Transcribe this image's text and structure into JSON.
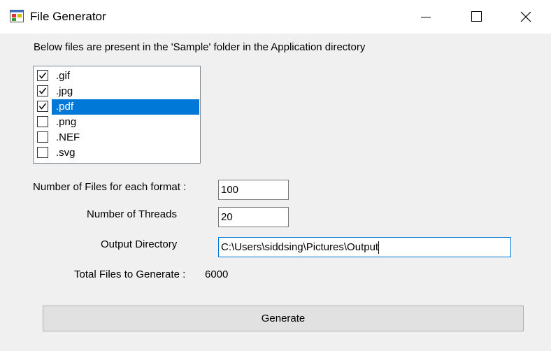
{
  "window": {
    "title": "File Generator",
    "icon": "app-form-icon"
  },
  "description": "Below files are present in the 'Sample'  folder in the Application directory",
  "formats": [
    {
      "label": ".gif",
      "checked": true,
      "selected": false
    },
    {
      "label": ".jpg",
      "checked": true,
      "selected": false
    },
    {
      "label": ".pdf",
      "checked": true,
      "selected": true
    },
    {
      "label": ".png",
      "checked": false,
      "selected": false
    },
    {
      "label": ".NEF",
      "checked": false,
      "selected": false
    },
    {
      "label": ".svg",
      "checked": false,
      "selected": false
    }
  ],
  "form": {
    "files_per_format_label": "Number of Files  for each format :",
    "files_per_format_value": "100",
    "threads_label": "Number of Threads",
    "threads_value": "20",
    "output_dir_label": "Output Directory",
    "output_dir_value": "C:\\Users\\siddsing\\Pictures\\Output",
    "total_label": "Total Files to Generate :",
    "total_value": "6000"
  },
  "generate_button": "Generate",
  "colors": {
    "selection": "#0078d7",
    "background": "#f0f0f0"
  }
}
